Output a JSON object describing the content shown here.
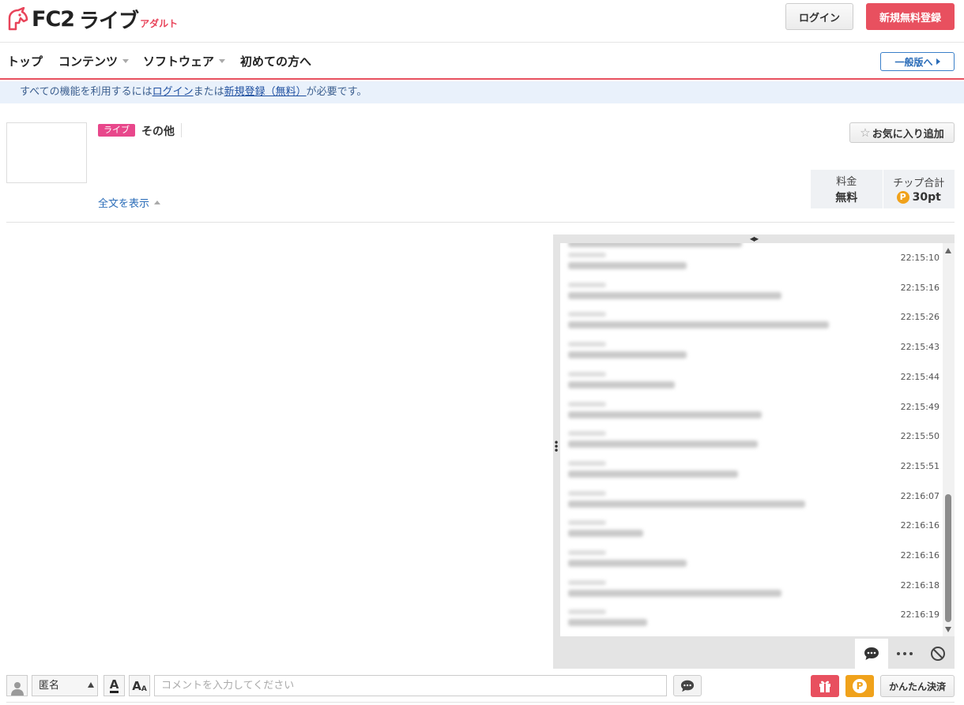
{
  "header": {
    "logo_text": "FC2",
    "logo_sub": "ライブ",
    "logo_tag": "アダルト",
    "login_label": "ログイン",
    "register_label": "新規無料登録"
  },
  "nav": {
    "items": [
      {
        "label": "トップ",
        "has_caret": false
      },
      {
        "label": "コンテンツ",
        "has_caret": true
      },
      {
        "label": "ソフトウェア",
        "has_caret": true
      },
      {
        "label": "初めての方へ",
        "has_caret": false
      }
    ],
    "general_label": "一般版へ"
  },
  "notice": {
    "prefix": "すべての機能を利用するには",
    "login_link": "ログイン",
    "middle": "または",
    "register_link": "新規登録（無料）",
    "suffix": "が必要です。"
  },
  "program": {
    "badge": "ライブ",
    "category": "その他",
    "show_all": "全文を表示",
    "favorite_label": "お気に入り追加",
    "fee_label": "料金",
    "fee_value": "無料",
    "tip_label": "チップ合計",
    "tip_value": "30pt",
    "coin_letter": "P"
  },
  "chat": {
    "messages": [
      {
        "time": "22:15:10"
      },
      {
        "time": "22:15:16"
      },
      {
        "time": "22:15:26"
      },
      {
        "time": "22:15:43"
      },
      {
        "time": "22:15:44"
      },
      {
        "time": "22:15:49"
      },
      {
        "time": "22:15:50"
      },
      {
        "time": "22:15:51"
      },
      {
        "time": "22:16:07"
      },
      {
        "time": "22:16:16"
      },
      {
        "time": "22:16:16"
      },
      {
        "time": "22:16:18"
      },
      {
        "time": "22:16:19"
      }
    ]
  },
  "composer": {
    "name_value": "匿名",
    "font_color_glyph": "A",
    "font_size_glyph": "A",
    "placeholder": "コメントを入力してください",
    "pay_label": "かんたん決済",
    "point_letter": "P"
  },
  "colors": {
    "accent": "#e8505f",
    "link": "#2a6cb8",
    "coin": "#f0a21b",
    "live_badge": "#e8478b"
  }
}
